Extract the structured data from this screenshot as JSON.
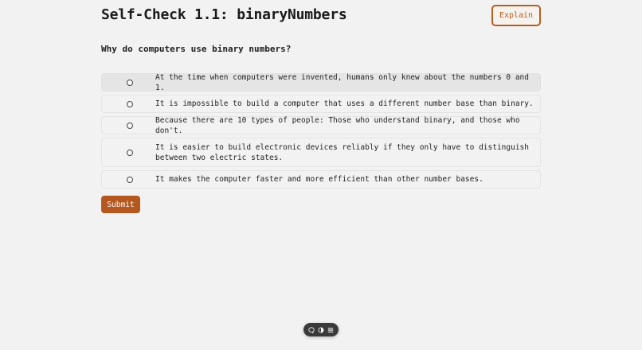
{
  "header": {
    "title": "Self-Check 1.1: binaryNumbers",
    "explain_label": "Explain"
  },
  "quiz": {
    "question": "Why do computers use binary numbers?",
    "options": [
      "At the time when computers were invented, humans only knew about the numbers 0 and 1.",
      "It is impossible to build a computer that uses a different number base than binary.",
      "Because there are 10 types of people: Those who understand binary, and those who don't.",
      "It is easier to build electronic devices reliably if they only have to distinguish between two electric states.",
      "It makes the computer faster and more efficient than other number bases."
    ],
    "submit_label": "Submit"
  },
  "toolbar": {
    "icons": [
      "chat-icon",
      "theme-toggle-icon",
      "menu-icon"
    ]
  },
  "colors": {
    "accent": "#b5581f",
    "background": "#f2f2f2",
    "toolbar": "#3a3a3a"
  }
}
